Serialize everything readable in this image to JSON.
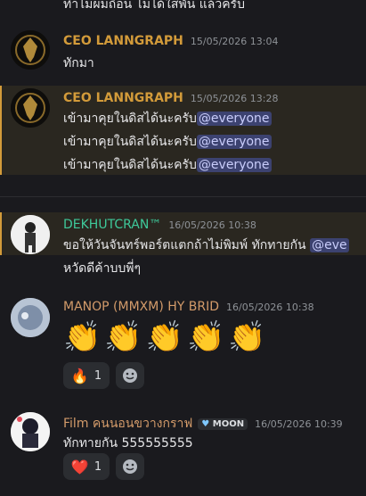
{
  "top_partial": {
    "text": "ทำไม่ผมถือน ไม่ได้ใส่พัน แล้วครับ"
  },
  "messages": [
    {
      "author": "CEO LANNGRAPH",
      "author_color": "#d39b3a",
      "timestamp": "15/05/2026 13:04",
      "lines": [
        "ทักมา"
      ]
    },
    {
      "author": "CEO LANNGRAPH",
      "author_color": "#d39b3a",
      "timestamp": "15/05/2026 13:28",
      "lines": [
        "เข้ามาคุยในดิสได้นะครับ",
        "เข้ามาคุยในดิสได้นะครับ",
        "เข้ามาคุยในดิสได้นะครับ"
      ],
      "mention": "@everyone"
    },
    {
      "author": "DEKHUTCRAN™",
      "author_color": "#3ec99a",
      "timestamp": "16/05/2026 10:38",
      "lines": [
        "ขอให้วันจันทร์พอร์ตแตกถ้าไม่พิมพ์ ทักทายกัน",
        "หวัดดีค้าบบพี่ๆ"
      ],
      "mention": "@eve"
    },
    {
      "author": "MANOP (MMXM) HY BRID",
      "author_color": "#d39b6a",
      "timestamp": "16/05/2026 10:38",
      "emojis": [
        "👏",
        "👏",
        "👏",
        "👏",
        "👏"
      ],
      "reaction": {
        "emoji": "🔥",
        "count": "1"
      }
    },
    {
      "author": "Film คนนอนขวางกราฟ",
      "author_color": "#d39b6a",
      "badge": "MOON",
      "timestamp": "16/05/2026 10:39",
      "lines": [
        "ทักทายกัน 555555555"
      ],
      "reaction": {
        "emoji": "❤️",
        "count": "1"
      }
    }
  ]
}
